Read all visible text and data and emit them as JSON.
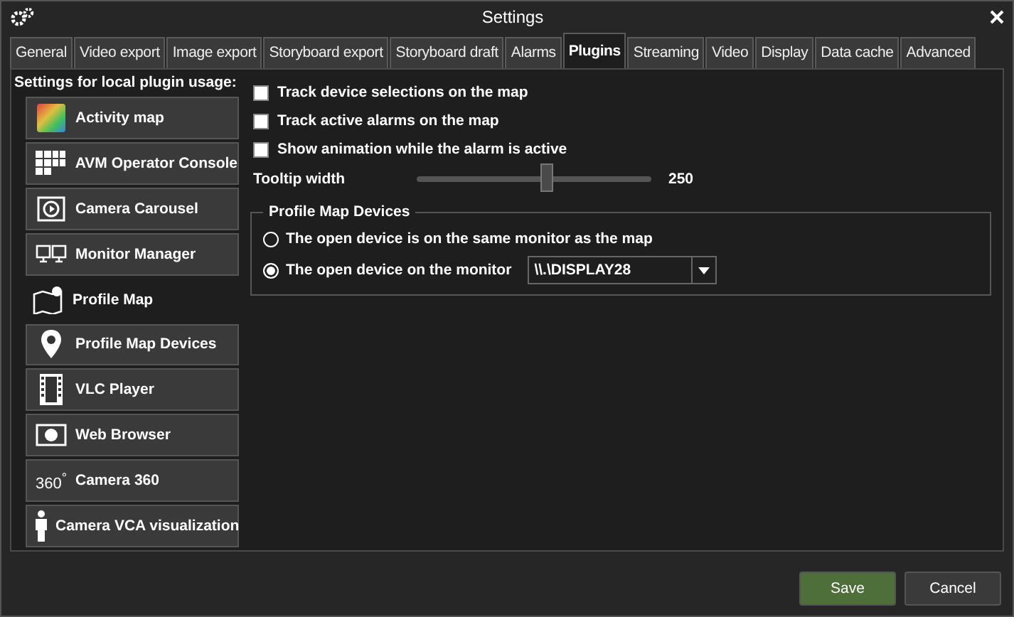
{
  "window": {
    "title": "Settings"
  },
  "tabs": [
    {
      "label": "General",
      "selected": false
    },
    {
      "label": "Video export",
      "selected": false
    },
    {
      "label": "Image export",
      "selected": false
    },
    {
      "label": "Storyboard export",
      "selected": false
    },
    {
      "label": "Storyboard draft",
      "selected": false
    },
    {
      "label": "Alarms",
      "selected": false
    },
    {
      "label": "Plugins",
      "selected": true
    },
    {
      "label": "Streaming",
      "selected": false
    },
    {
      "label": "Video",
      "selected": false
    },
    {
      "label": "Display",
      "selected": false
    },
    {
      "label": "Data cache",
      "selected": false
    },
    {
      "label": "Advanced",
      "selected": false
    }
  ],
  "heading": "Settings for local plugin usage:",
  "plugins": [
    {
      "label": "Activity map",
      "selected": false
    },
    {
      "label": "AVM Operator Console",
      "selected": false
    },
    {
      "label": "Camera Carousel",
      "selected": false
    },
    {
      "label": "Monitor Manager",
      "selected": false
    },
    {
      "label": "Profile Map",
      "selected": true
    },
    {
      "label": "Profile Map Devices",
      "selected": false
    },
    {
      "label": "VLC Player",
      "selected": false
    },
    {
      "label": "Web Browser",
      "selected": false
    },
    {
      "label": "Camera 360",
      "icon_text": "360$^{°}$",
      "selected": false
    },
    {
      "label": "Camera VCA visualization",
      "selected": false
    }
  ],
  "options": [
    {
      "label": "Track device selections on the map",
      "checked": false
    },
    {
      "label": "Track active alarms on the map",
      "checked": false
    },
    {
      "label": "Show animation while the alarm is active",
      "checked": false
    }
  ],
  "tooltip": {
    "label": "Tooltip width",
    "level": 0.56,
    "reading": "250"
  },
  "group": {
    "title": "Profile Map Devices",
    "radios": [
      {
        "label": "The open device is on the same monitor as the map",
        "selected": false
      },
      {
        "label": "The open device on the monitor",
        "selected": true,
        "dropdown": "\\\\.\\DISPLAY28"
      }
    ]
  },
  "buttons": [
    {
      "label": "Save",
      "kind": "primary"
    },
    {
      "label": "Cancel",
      "kind": "normal"
    }
  ]
}
